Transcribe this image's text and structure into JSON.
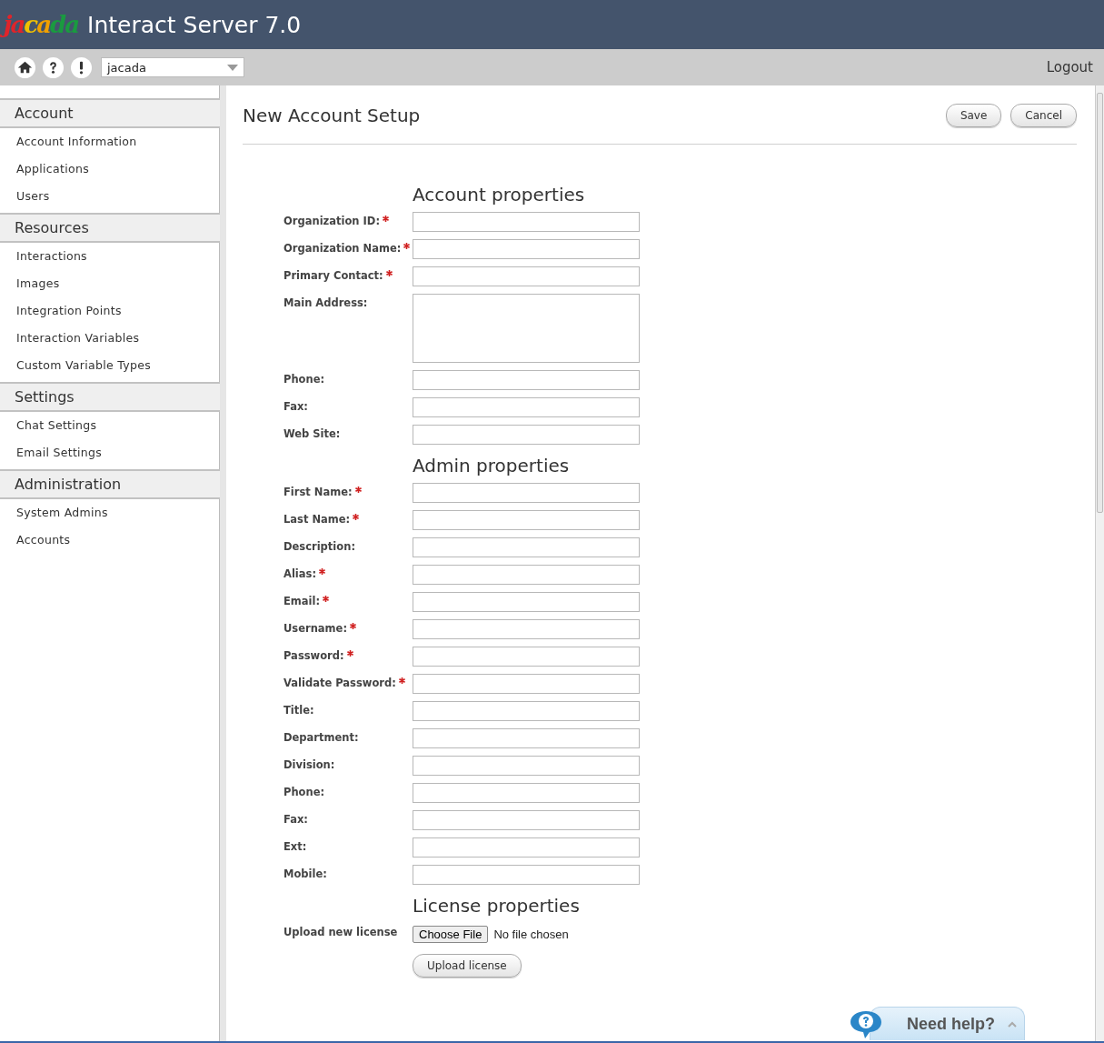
{
  "header": {
    "logo": "jacada",
    "title": "Interact Server 7.0"
  },
  "toolbar": {
    "account_select": "jacada",
    "logout": "Logout"
  },
  "sidebar": {
    "sections": [
      {
        "title": "Account",
        "items": [
          "Account Information",
          "Applications",
          "Users"
        ]
      },
      {
        "title": "Resources",
        "items": [
          "Interactions",
          "Images",
          "Integration Points",
          "Interaction Variables",
          "Custom Variable Types"
        ]
      },
      {
        "title": "Settings",
        "items": [
          "Chat Settings",
          "Email Settings"
        ]
      },
      {
        "title": "Administration",
        "items": [
          "System Admins",
          "Accounts"
        ]
      }
    ]
  },
  "page": {
    "title": "New Account Setup",
    "buttons": [
      "Save",
      "Cancel"
    ]
  },
  "sections": [
    {
      "title": "Account properties",
      "fields": [
        {
          "label": "Organization ID:",
          "required": true,
          "kind": "text"
        },
        {
          "label": "Organization Name:",
          "required": true,
          "kind": "text"
        },
        {
          "label": "Primary Contact:",
          "required": true,
          "kind": "text"
        },
        {
          "label": "Main Address:",
          "required": false,
          "kind": "textarea"
        },
        {
          "label": "Phone:",
          "required": false,
          "kind": "text"
        },
        {
          "label": "Fax:",
          "required": false,
          "kind": "text"
        },
        {
          "label": "Web Site:",
          "required": false,
          "kind": "text"
        }
      ]
    },
    {
      "title": "Admin properties",
      "fields": [
        {
          "label": "First Name:",
          "required": true,
          "kind": "text"
        },
        {
          "label": "Last Name:",
          "required": true,
          "kind": "text"
        },
        {
          "label": "Description:",
          "required": false,
          "kind": "text"
        },
        {
          "label": "Alias:",
          "required": true,
          "kind": "text"
        },
        {
          "label": "Email:",
          "required": true,
          "kind": "text"
        },
        {
          "label": "Username:",
          "required": true,
          "kind": "text"
        },
        {
          "label": "Password:",
          "required": true,
          "kind": "password"
        },
        {
          "label": "Validate Password:",
          "required": true,
          "kind": "password"
        },
        {
          "label": "Title:",
          "required": false,
          "kind": "text"
        },
        {
          "label": "Department:",
          "required": false,
          "kind": "text"
        },
        {
          "label": "Division:",
          "required": false,
          "kind": "text"
        },
        {
          "label": "Phone:",
          "required": false,
          "kind": "text"
        },
        {
          "label": "Fax:",
          "required": false,
          "kind": "text"
        },
        {
          "label": "Ext:",
          "required": false,
          "kind": "text"
        },
        {
          "label": "Mobile:",
          "required": false,
          "kind": "text"
        }
      ]
    },
    {
      "title": "License properties",
      "fields": [
        {
          "label": "Upload new license",
          "required": false,
          "kind": "file",
          "button": "Choose File",
          "status": "No file chosen",
          "action": "Upload license"
        }
      ]
    }
  ],
  "help": {
    "label": "Need help?"
  }
}
